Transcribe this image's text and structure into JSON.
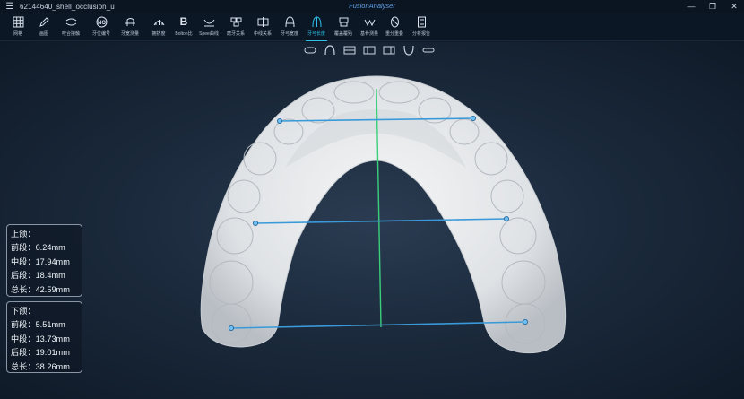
{
  "window": {
    "menu_icon": "hamburger-icon",
    "document_title": "62144640_shell_occlusion_u",
    "app_title": "FusionAnalyser",
    "controls": [
      "minimize-icon",
      "restore-icon",
      "close-icon"
    ]
  },
  "toolbar": {
    "active_index": 11,
    "tools": [
      {
        "label": "网格",
        "icon": "grid-icon"
      },
      {
        "label": "画图",
        "icon": "pencil-icon"
      },
      {
        "label": "咬合接触",
        "icon": "occlusion-contact-icon"
      },
      {
        "label": "牙位编号",
        "icon": "tooth-number-icon"
      },
      {
        "label": "牙宽测量",
        "icon": "tooth-width-icon"
      },
      {
        "label": "拥挤度",
        "icon": "crowding-icon"
      },
      {
        "label": "Bolton比",
        "icon": "bolton-icon",
        "glyph": "B"
      },
      {
        "label": "Spee曲线",
        "icon": "spee-curve-icon"
      },
      {
        "label": "磨牙关系",
        "icon": "molar-relation-icon"
      },
      {
        "label": "中线关系",
        "icon": "midline-relation-icon"
      },
      {
        "label": "牙弓宽度",
        "icon": "arch-width-icon"
      },
      {
        "label": "牙弓长度",
        "icon": "arch-length-icon"
      },
      {
        "label": "覆盖覆殆",
        "icon": "overjet-overbite-icon"
      },
      {
        "label": "基骨测量",
        "icon": "basal-bone-icon"
      },
      {
        "label": "重分重叠",
        "icon": "overlap-icon"
      },
      {
        "label": "分析报告",
        "icon": "report-icon"
      }
    ]
  },
  "view_tools": [
    "front-view-icon",
    "top-view-icon",
    "left-view-icon",
    "right-view-icon",
    "back-view-icon",
    "bottom-view-icon",
    "side-view-icon"
  ],
  "measurements": {
    "upper": {
      "title": "上颌：",
      "front_label": "前段：",
      "front_value": "6.24mm",
      "middle_label": "中段：",
      "middle_value": "17.94mm",
      "back_label": "后段：",
      "back_value": "18.4mm",
      "total_label": "总长：",
      "total_value": "42.59mm"
    },
    "lower": {
      "title": "下颌：",
      "front_label": "前段：",
      "front_value": "5.51mm",
      "middle_label": "中段：",
      "middle_value": "13.73mm",
      "back_label": "后段：",
      "back_value": "19.01mm",
      "total_label": "总长：",
      "total_value": "38.26mm"
    }
  },
  "colors": {
    "accent": "#2ec1e8",
    "measure_line": "#3a9ad9",
    "midline": "#3ad07a",
    "model": "#e4e7ea"
  }
}
